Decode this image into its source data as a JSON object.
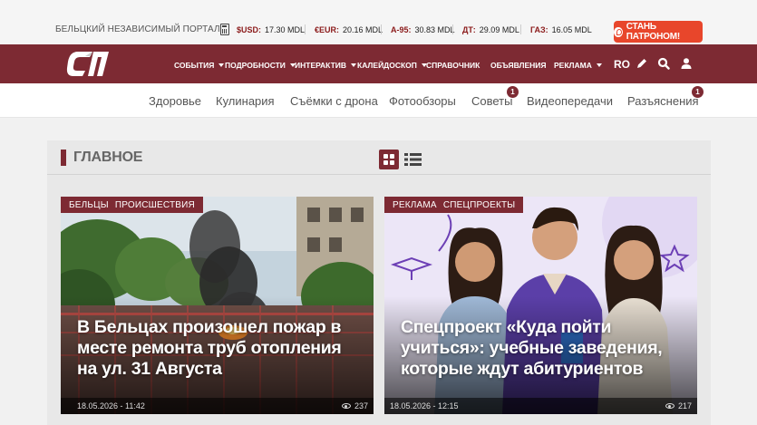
{
  "topbar": {
    "portal_name": "БЕЛЬЦКИЙ НЕЗАВИСИМЫЙ ПОРТАЛ",
    "rates": [
      {
        "label": "$USD:",
        "value": "17.30 MDL"
      },
      {
        "label": "€EUR:",
        "value": "20.16 MDL"
      },
      {
        "label": "А-95:",
        "value": "30.83 MDL"
      },
      {
        "label": "ДТ:",
        "value": "29.09 MDL"
      },
      {
        "label": "ГАЗ:",
        "value": "16.05 MDL"
      }
    ],
    "patron_label": "СТАНЬ ПАТРОНОМ!"
  },
  "mainnav": {
    "logo_text": "СП",
    "items": [
      {
        "label": "СОБЫТИЯ",
        "dropdown": true
      },
      {
        "label": "ПОДРОБНОСТИ",
        "dropdown": true
      },
      {
        "label": "ИНТЕРАКТИВ",
        "dropdown": true
      },
      {
        "label": "КАЛЕЙДОСКОП",
        "dropdown": true
      },
      {
        "label": "СПРАВОЧНИК",
        "dropdown": false
      },
      {
        "label": "ОБЪЯВЛЕНИЯ",
        "dropdown": false
      },
      {
        "label": "РЕКЛАМА",
        "dropdown": true
      }
    ],
    "lang": "RO",
    "icons": [
      "pencil-icon",
      "search-icon",
      "user-icon"
    ]
  },
  "subnav": {
    "items": [
      {
        "label": "Здоровье",
        "badge": ""
      },
      {
        "label": "Кулинария",
        "badge": ""
      },
      {
        "label": "Съёмки с дрона",
        "badge": ""
      },
      {
        "label": "Фотообзоры",
        "badge": ""
      },
      {
        "label": "Советы",
        "badge": "1"
      },
      {
        "label": "Видеопередачи",
        "badge": ""
      },
      {
        "label": "Разъяснения",
        "badge": "1"
      }
    ]
  },
  "main": {
    "section_title": "ГЛАВНОЕ",
    "cards": [
      {
        "tags": [
          "БЕЛЬЦЫ",
          "ПРОИСШЕСТВИЯ"
        ],
        "title": "В Бельцах произошел пожар в месте ремонта труб отопления на ул. 31 Августа",
        "date": "18.05.2026 - 11:42",
        "views": "237"
      },
      {
        "tags": [
          "РЕКЛАМА",
          "СПЕЦПРОЕКТЫ"
        ],
        "title": "Спецпроект «Куда пойти учиться»: учебные заведения, которые ждут абитуриентов",
        "date": "18.05.2026 - 12:15",
        "views": "217"
      }
    ]
  },
  "colors": {
    "brand": "#7d2a33",
    "patron": "#e8462b",
    "page_bg": "#f1f1f1"
  }
}
